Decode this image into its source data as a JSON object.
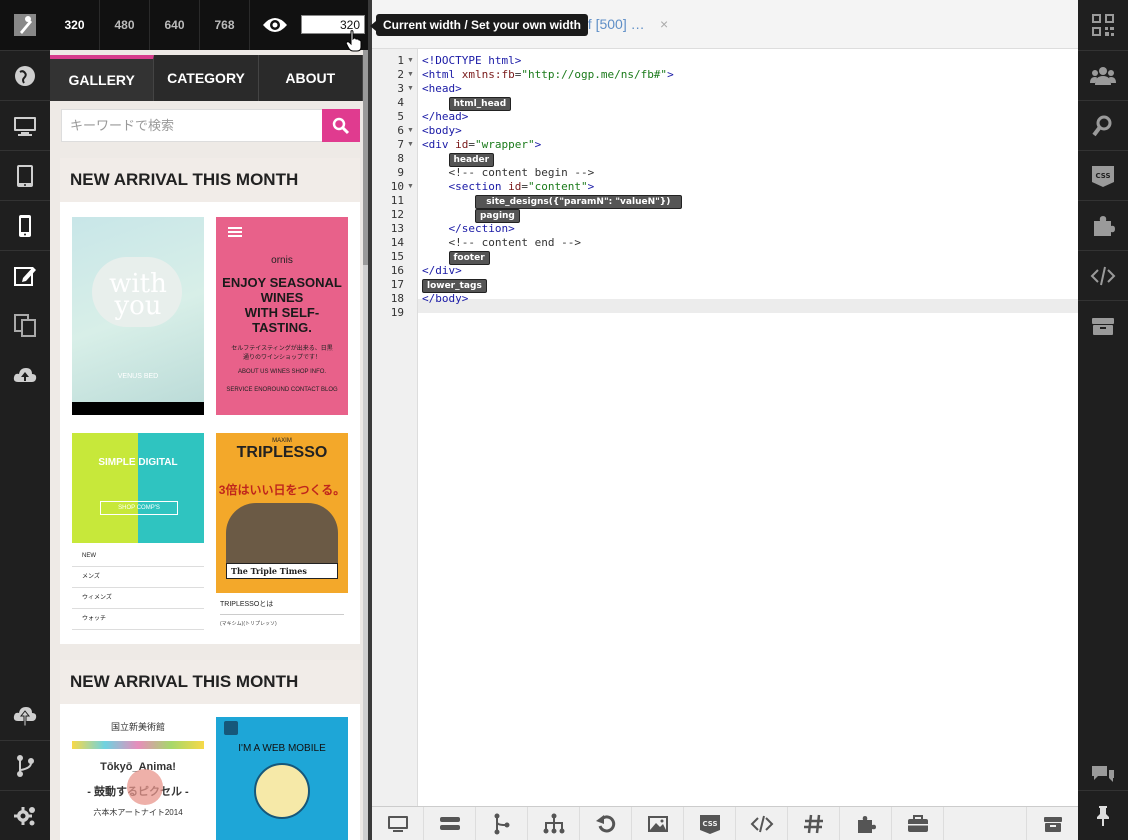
{
  "widths": [
    {
      "label": "320",
      "selected": true
    },
    {
      "label": "480",
      "selected": false
    },
    {
      "label": "640",
      "selected": false
    },
    {
      "label": "768",
      "selected": false
    }
  ],
  "width_input": {
    "value": "320"
  },
  "tooltip": {
    "tab": "current",
    "text": "Current width / Set your own width"
  },
  "editor": {
    "page_info": "of [500] …",
    "close": "×"
  },
  "preview": {
    "nav": [
      "GALLERY",
      "CATEGORY",
      "ABOUT"
    ],
    "search_placeholder": "キーワードで検索",
    "section_title": "NEW ARRIVAL THIS MONTH",
    "thumb1": {
      "title1": "with",
      "title2": "you",
      "sub": "VENUS BED"
    },
    "thumb2": {
      "brand": "ornis",
      "l1": "ENJOY SEASONAL",
      "l2": "WINES",
      "l3": "WITH SELF-TASTING.",
      "jp": "セルフテイスティングが出来る、日黒通りのワインショップです！",
      "links": "ABOUT US   WINES   SHOP INFO.",
      "links2": "SERVICE  ENOROUND  CONTACT  BLOG"
    },
    "thumb3": {
      "title": "SIMPLE DIGITAL",
      "btn": "SHOP COMP'S",
      "items": [
        "NEW",
        "メンズ",
        "ウィメンズ",
        "ウォッチ"
      ]
    },
    "thumb4": {
      "brand": "MAXIM",
      "title": "TRIPLESSO",
      "jp": "3倍はいい日をつくる。",
      "paper": "The Triple Times",
      "item1": "TRIPLESSOとは",
      "item2": "(マキシム)(トリプレッソ)"
    },
    "thumb5": {
      "jp": "国立新美術館",
      "title": "Tōkyō_Anima!",
      "sub": "- 鼓動するピクセル -",
      "sub2": "六本木アートナイト2014"
    },
    "thumb6": {
      "title": "I'M A WEB MOBILE"
    }
  },
  "code_lines": [
    {
      "n": 1,
      "fold": true,
      "html": "<span class='tag'>&lt;!DOCTYPE html&gt;</span>"
    },
    {
      "n": 2,
      "fold": true,
      "html": "<span class='tag'>&lt;html</span> <span class='attr'>xmlns:fb</span>=<span class='str'>\"http://ogp.me/ns/fb#\"</span><span class='tag'>&gt;</span>"
    },
    {
      "n": 3,
      "fold": true,
      "html": "<span class='tag'>&lt;head&gt;</span>"
    },
    {
      "n": 4,
      "fold": false,
      "html": "    <span class='chip'>html_head</span>"
    },
    {
      "n": 5,
      "fold": false,
      "html": "<span class='tag'>&lt;/head&gt;</span>"
    },
    {
      "n": 6,
      "fold": true,
      "html": "<span class='tag'>&lt;body&gt;</span>"
    },
    {
      "n": 7,
      "fold": true,
      "html": "<span class='tag'>&lt;div</span> <span class='attr'>id</span>=<span class='str'>\"wrapper\"</span><span class='tag'>&gt;</span>"
    },
    {
      "n": 8,
      "fold": false,
      "html": "    <span class='chip'>header</span>"
    },
    {
      "n": 9,
      "fold": false,
      "html": "    <span class='cm'>&lt;!-- content begin --&gt;</span>"
    },
    {
      "n": 10,
      "fold": true,
      "html": "    <span class='tag'>&lt;section</span> <span class='attr'>id</span>=<span class='str'>\"content\"</span><span class='tag'>&gt;</span>"
    },
    {
      "n": 11,
      "fold": false,
      "html": "        <span class='chip'>  site_designs({\"paramN\": \"valueN\"})  </span>"
    },
    {
      "n": 12,
      "fold": false,
      "html": "        <span class='chip'>paging</span>"
    },
    {
      "n": 13,
      "fold": false,
      "html": "    <span class='tag'>&lt;/section&gt;</span>"
    },
    {
      "n": 14,
      "fold": false,
      "html": "    <span class='cm'>&lt;!-- content end --&gt;</span>"
    },
    {
      "n": 15,
      "fold": false,
      "html": "    <span class='chip'>footer</span>"
    },
    {
      "n": 16,
      "fold": false,
      "html": "<span class='tag'>&lt;/div&gt;</span>"
    },
    {
      "n": 17,
      "fold": false,
      "html": "<span class='chip'>lower_tags</span>"
    },
    {
      "n": 18,
      "fold": false,
      "html": "<span class='tag'>&lt;/body&gt;</span>"
    },
    {
      "n": 19,
      "fold": false,
      "html": ""
    }
  ],
  "left_sidebar": [
    "logo-icon",
    "globe-icon",
    "desktop-icon",
    "tablet-icon",
    "mobile-icon",
    "edit-icon",
    "copy-icon",
    "cloud-upload-icon",
    "cloud-sync-icon",
    "branch-icon",
    "gear-icon"
  ],
  "right_sidebar": [
    "qr-code-icon",
    "users-icon",
    "search-icon",
    "css-icon",
    "puzzle-icon",
    "code-icon",
    "archive-icon",
    "chat-icon",
    "pin-icon"
  ],
  "bottom_bar": [
    "desktop-icon",
    "rows-icon",
    "tree-icon",
    "sitemap-icon",
    "undo-icon",
    "image-icon",
    "css-icon",
    "code-icon",
    "hash-icon",
    "puzzle-icon",
    "briefcase-icon",
    "archive-icon"
  ],
  "colors": {
    "accent": "#d63d8d",
    "sidebar": "#1f1f1f",
    "link": "#5f8fc7"
  }
}
